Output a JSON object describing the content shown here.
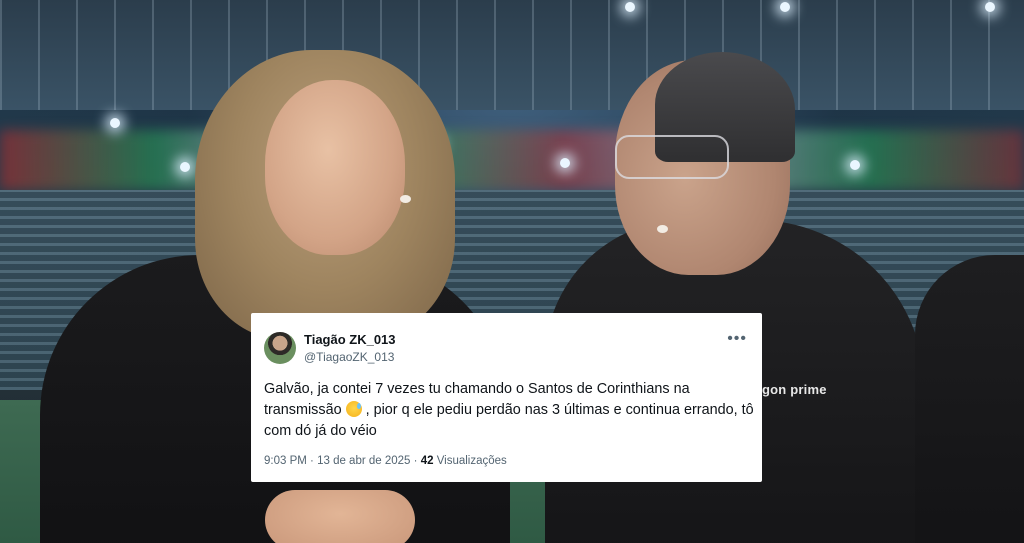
{
  "tweet": {
    "display_name": "Tiagão ZK_013",
    "handle": "@TiagaoZK_013",
    "more_icon": "more-horizontal-icon",
    "text_part1": "Galvão, ja contei 7 vezes tu chamando o Santos de Corinthians na transmissão ",
    "emoji": "grinning-sweat-emoji",
    "text_part2": " , pior q ele pediu perdão nas 3 últimas e continua errando, tô com dó já do véio",
    "time": "9:03 PM",
    "separator": "·",
    "date": "13 de abr de 2025",
    "views_count": "42",
    "views_label": "Visualizações"
  },
  "background": {
    "overlay_text": "gon prime"
  }
}
